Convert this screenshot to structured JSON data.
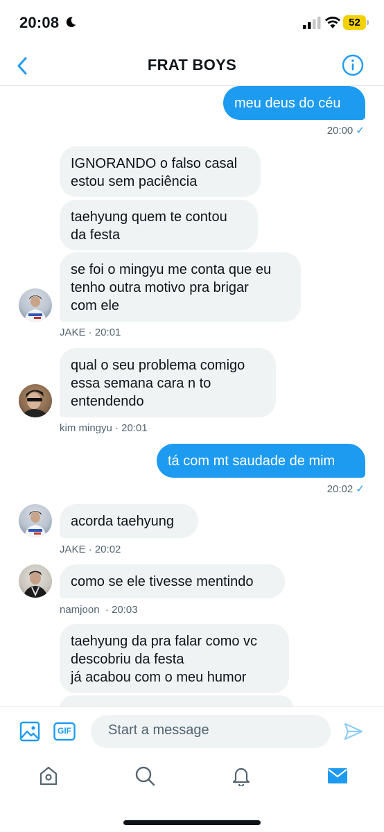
{
  "status_bar": {
    "time": "20:08",
    "battery": "52"
  },
  "header": {
    "title": "FRAT BOYS"
  },
  "messages": [
    {
      "type": "sent",
      "text": "meu deus do céu",
      "meta": "20:00"
    },
    {
      "type": "recv",
      "text": "IGNORANDO o falso casal\nestou sem paciência"
    },
    {
      "type": "recv",
      "text": "taehyung quem te contou\nda festa"
    },
    {
      "type": "recv",
      "text": "se foi o mingyu me conta que eu\ntenho outra motivo pra brigar\ncom ele",
      "meta": "JAKE · 20:01"
    },
    {
      "type": "recv",
      "text": "qual o seu problema comigo\nessa semana cara n to\nentendendo",
      "meta": "kim mingyu · 20:01"
    },
    {
      "type": "sent",
      "text": "tá com mt saudade de mim",
      "meta": "20:02"
    },
    {
      "type": "recv",
      "text": "acorda taehyung",
      "meta": "JAKE · 20:02"
    },
    {
      "type": "recv",
      "text": "como se ele tivesse mentindo",
      "meta": "namjoon  · 20:03"
    },
    {
      "type": "recv",
      "text": "taehyung da pra falar como vc\ndescobriu da festa\njá acabou com o meu humor"
    }
  ],
  "composer": {
    "placeholder": "Start a message",
    "gif_label": "GIF"
  },
  "tabs": [
    "home-icon",
    "search-icon",
    "notifications-icon",
    "messages-icon"
  ],
  "colors": {
    "accent": "#1d9bf0",
    "bubble_recv": "#eff3f4",
    "meta": "#536471"
  }
}
